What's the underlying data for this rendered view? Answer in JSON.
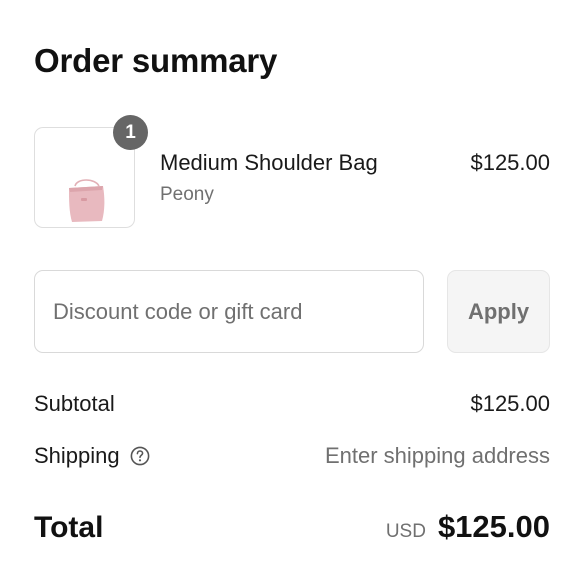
{
  "title": "Order summary",
  "product": {
    "quantity": "1",
    "name": "Medium Shoulder Bag",
    "variant": "Peony",
    "price": "$125.00",
    "image_icon": "pink-shoulder-bag-image"
  },
  "discount": {
    "placeholder": "Discount code or gift card",
    "value": "",
    "apply_label": "Apply"
  },
  "subtotal": {
    "label": "Subtotal",
    "value": "$125.00"
  },
  "shipping": {
    "label": "Shipping",
    "help_icon": "question-circle-icon",
    "value": "Enter shipping address"
  },
  "total": {
    "label": "Total",
    "currency": "USD",
    "amount": "$125.00"
  },
  "colors": {
    "badge": "#666666",
    "muted_text": "#707070",
    "bag": "#e8b9bf"
  }
}
